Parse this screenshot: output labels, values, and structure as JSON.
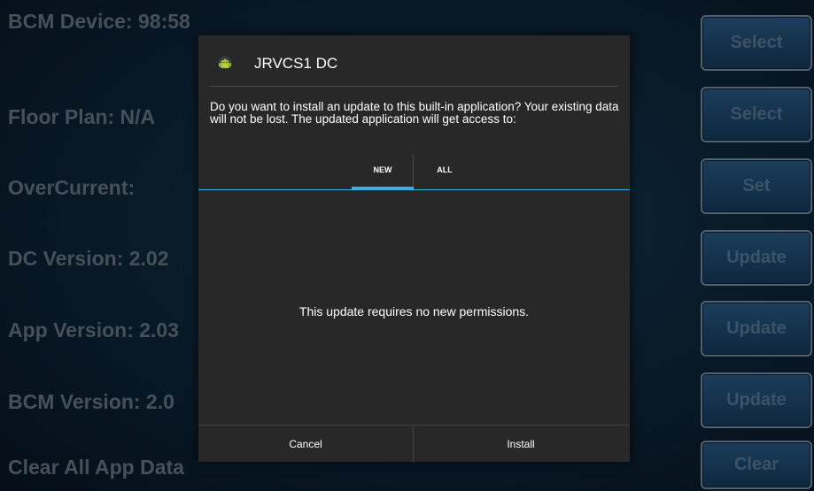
{
  "background": {
    "labels": [
      "BCM Device: 98:58",
      "Floor Plan:  N/A",
      "OverCurrent:",
      "DC Version:  2.02",
      "App Version:  2.03",
      "BCM Version:  2.0",
      "Clear All App Data"
    ],
    "buttons": [
      "Select",
      "Select",
      "Set",
      "Update",
      "Update",
      "Update",
      "Clear"
    ]
  },
  "dialog": {
    "title": "JRVCS1 DC",
    "icon": "android-icon",
    "message": "Do you want to install an update to this built-in application? Your existing data will not be lost. The updated application will get access to:",
    "tabs": [
      {
        "label": "NEW",
        "selected": true
      },
      {
        "label": "ALL",
        "selected": false
      }
    ],
    "body_text": "This update requires no new permissions.",
    "cancel_label": "Cancel",
    "install_label": "Install"
  },
  "colors": {
    "accent": "#33b5e5",
    "dialog_bg": "#282828",
    "button_bg": "#1f4e78"
  }
}
